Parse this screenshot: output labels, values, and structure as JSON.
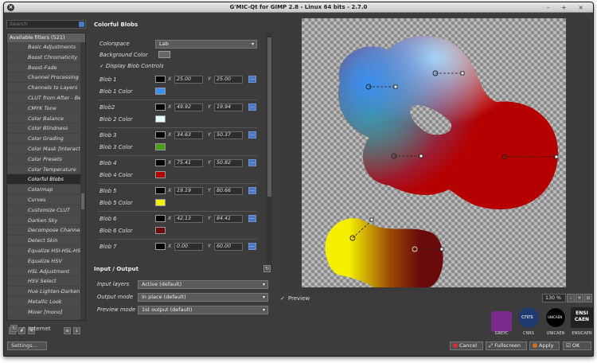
{
  "window": {
    "title": "G'MIC-Qt for GIMP 2.8 - Linux 64 bits - 2.7.0",
    "controls": "– + ×"
  },
  "left": {
    "search_placeholder": "Search",
    "list_header": "Available filters (521)",
    "filters": [
      "Basic Adjustments",
      "Boost Chromaticity",
      "Boost-Fade",
      "Channel Processing",
      "Channels to Layers",
      "CLUT from After - Be",
      "CMYK Tone",
      "Color Balance",
      "Color Blindness",
      "Color Grading",
      "Color Mask [Interacti",
      "Color Presets",
      "Color Temperature",
      "Colorful Blobs",
      "Colormap",
      "Curves",
      "Customize CLUT",
      "Darken Sky",
      "Decompose Channel",
      "Detect Skin",
      "Equalize HSI-HSL-HS",
      "Equalize HSV",
      "HSL Adjustment",
      "HSV Select",
      "Hue Lighten-Darken",
      "Metallic Look",
      "Mixer [mono]"
    ],
    "selected_filter": "Colorful Blobs",
    "internet_label": "Internet",
    "settings_label": "Settings..."
  },
  "params": {
    "filter_title": "Colorful Blobs",
    "colorspace_label": "Colorspace",
    "colorspace_value": "Lab",
    "background_color_label": "Background Color",
    "display_controls_label": "Display Blob Controls",
    "x_label": "X",
    "y_label": "Y",
    "blobs": [
      {
        "label": "Blob 1",
        "x": "25.00",
        "y": "25.00",
        "color_label": "Blob 1 Color",
        "color": "#3a8ef0"
      },
      {
        "label": "Blob2",
        "x": "49.92",
        "y": "19.94",
        "color_label": "Blob 2 Color",
        "color": "#e8ffff"
      },
      {
        "label": "Blob 3",
        "x": "34.63",
        "y": "50.37",
        "color_label": "Blob 3 Color",
        "color": "#4aa014"
      },
      {
        "label": "Blob 4",
        "x": "75.41",
        "y": "50.82",
        "color_label": "Blob 4 Color",
        "color": "#b50000"
      },
      {
        "label": "Blob 5",
        "x": "19.19",
        "y": "80.66",
        "color_label": "Blob 5 Color",
        "color": "#f5f000"
      },
      {
        "label": "Blob 6",
        "x": "42.13",
        "y": "84.41",
        "color_label": "Blob 6 Color",
        "color": "#6a0a0a"
      },
      {
        "label": "Blob 7",
        "x": "0.00",
        "y": "60.00",
        "color_label": "",
        "color": "#000000"
      }
    ]
  },
  "io": {
    "title": "Input / Output",
    "input_layers_label": "Input layers",
    "input_layers_value": "Active (default)",
    "output_mode_label": "Output mode",
    "output_mode_value": "In place (default)",
    "preview_mode_label": "Preview mode",
    "preview_mode_value": "1st output (default)"
  },
  "preview": {
    "preview_label": "Preview",
    "zoom": "130 %"
  },
  "logos": {
    "greyc": "GREYC",
    "cnrs": "CNRS",
    "unicaen": "UNICAEN",
    "ensicaen": "ENSICAEN",
    "cnrs_mark": "cnrs",
    "unicaen_mark": "UNICAEN",
    "ensi_mark": "ENSI\nCAEN"
  },
  "buttons": {
    "cancel": "Cancel",
    "fullscreen": "Fullscreen",
    "apply": "Apply",
    "ok": "OK"
  },
  "colors": {
    "cancel_icon": "#d03030",
    "apply_icon": "#d07020",
    "accent": "#4a78c0"
  }
}
